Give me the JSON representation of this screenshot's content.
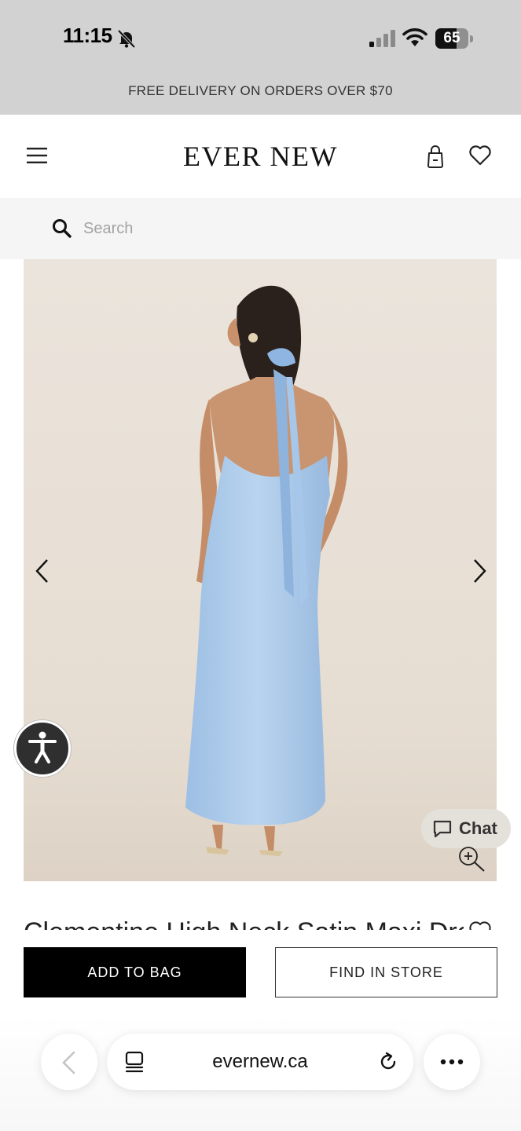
{
  "status_bar": {
    "time": "11:15",
    "battery_level": "65",
    "battery_fraction": 0.65,
    "icons": [
      "bell-slash-icon",
      "cellular-signal-icon",
      "wifi-icon",
      "battery-icon"
    ]
  },
  "promo": {
    "text": "FREE DELIVERY ON ORDERS OVER $70"
  },
  "header": {
    "logo": "EVER NEW",
    "icons": [
      "hamburger-menu-icon",
      "shopping-bag-icon",
      "wishlist-heart-icon"
    ]
  },
  "search": {
    "placeholder": "Search",
    "value": ""
  },
  "product": {
    "image_alt": "Woman wearing a light blue satin halter neck maxi dress with a tie at the neck, shown from the back",
    "title": "Clementine High Neck Satin Maxi Dress",
    "colors": {
      "dress": "#a9c9ea",
      "background": "#e8dfd5"
    }
  },
  "carousel": {
    "prev_icon": "chevron-left-icon",
    "next_icon": "chevron-right-icon"
  },
  "chat": {
    "label": "Chat"
  },
  "actions": {
    "add_to_bag": "ADD TO BAG",
    "find_in_store": "FIND IN STORE"
  },
  "browser": {
    "url": "evernew.ca",
    "icons": [
      "back-arrow-icon",
      "tabs-icon",
      "reload-icon",
      "more-icon"
    ]
  }
}
